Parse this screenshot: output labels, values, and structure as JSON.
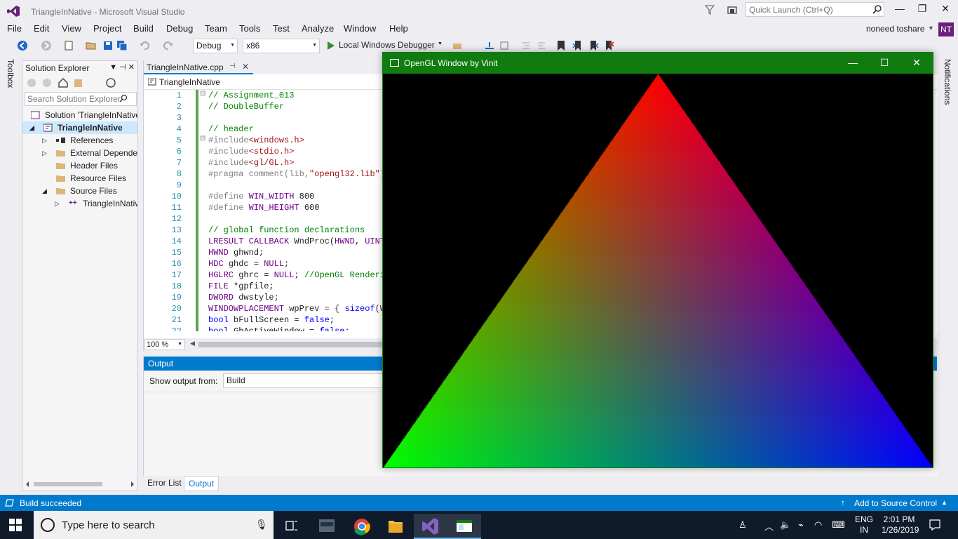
{
  "window": {
    "title": "TriangleInNative - Microsoft Visual Studio",
    "quick_launch_placeholder": "Quick Launch (Ctrl+Q)",
    "controls": {
      "minimize": "—",
      "restore": "❐",
      "close": "✕"
    }
  },
  "menu": {
    "items": [
      "File",
      "Edit",
      "View",
      "Project",
      "Build",
      "Debug",
      "Team",
      "Tools",
      "Test",
      "Analyze",
      "Window",
      "Help"
    ],
    "user": "noneed toshare",
    "avatar_initials": "NT"
  },
  "toolbar": {
    "configuration": "Debug",
    "platform": "x86",
    "debugger": "Local Windows Debugger"
  },
  "toolbox_label": "Toolbox",
  "notifications_label": "Notifications",
  "solution_explorer": {
    "title": "Solution Explorer",
    "search_placeholder": "Search Solution Explorer",
    "tree": [
      {
        "label": "Solution 'TriangleInNative'",
        "icon": "solution-icon"
      },
      {
        "label": "TriangleInNative",
        "icon": "project-icon",
        "selected": true
      },
      {
        "label": "References",
        "icon": "references-icon"
      },
      {
        "label": "External Dependencies",
        "icon": "folder-icon"
      },
      {
        "label": "Header Files",
        "icon": "folder-icon"
      },
      {
        "label": "Resource Files",
        "icon": "folder-icon"
      },
      {
        "label": "Source Files",
        "icon": "folder-icon"
      },
      {
        "label": "TriangleInNative.cpp",
        "icon": "cpp-file-icon"
      }
    ]
  },
  "editor": {
    "tab": "TriangleInNative.cpp",
    "nav_scope": "TriangleInNative",
    "zoom": "100 %",
    "lines": [
      {
        "n": "1",
        "parts": [
          {
            "c": "c-comment",
            "t": "// Assignment_013"
          }
        ]
      },
      {
        "n": "2",
        "parts": [
          {
            "c": "c-comment",
            "t": "// DoubleBuffer"
          }
        ]
      },
      {
        "n": "3",
        "parts": []
      },
      {
        "n": "4",
        "parts": [
          {
            "c": "c-comment",
            "t": "// header"
          }
        ]
      },
      {
        "n": "5",
        "parts": [
          {
            "c": "c-pre",
            "t": "#include"
          },
          {
            "c": "c-str",
            "t": "<windows.h>"
          }
        ]
      },
      {
        "n": "6",
        "parts": [
          {
            "c": "c-pre",
            "t": "#include"
          },
          {
            "c": "c-str",
            "t": "<stdio.h>"
          }
        ]
      },
      {
        "n": "7",
        "parts": [
          {
            "c": "c-pre",
            "t": "#include"
          },
          {
            "c": "c-str",
            "t": "<gl/GL.h>"
          }
        ]
      },
      {
        "n": "8",
        "parts": [
          {
            "c": "c-pre",
            "t": "#pragma comment(lib,"
          },
          {
            "c": "c-str",
            "t": "\"opengl32.lib\""
          },
          {
            "c": "c-pre",
            "t": ")"
          }
        ]
      },
      {
        "n": "9",
        "parts": []
      },
      {
        "n": "10",
        "parts": [
          {
            "c": "c-pre",
            "t": "#define "
          },
          {
            "c": "c-macro",
            "t": "WIN_WIDTH"
          },
          {
            "c": "",
            "t": " 800"
          }
        ]
      },
      {
        "n": "11",
        "parts": [
          {
            "c": "c-pre",
            "t": "#define "
          },
          {
            "c": "c-macro",
            "t": "WIN_HEIGHT"
          },
          {
            "c": "",
            "t": " 600"
          }
        ]
      },
      {
        "n": "12",
        "parts": []
      },
      {
        "n": "13",
        "parts": [
          {
            "c": "c-comment",
            "t": "// global function declarations"
          }
        ]
      },
      {
        "n": "14",
        "parts": [
          {
            "c": "c-macro",
            "t": "LRESULT"
          },
          {
            "c": "",
            "t": " "
          },
          {
            "c": "c-macro",
            "t": "CALLBACK"
          },
          {
            "c": "",
            "t": " WndProc("
          },
          {
            "c": "c-macro",
            "t": "HWND"
          },
          {
            "c": "",
            "t": ", "
          },
          {
            "c": "c-macro",
            "t": "UINT"
          },
          {
            "c": "",
            "t": ","
          }
        ]
      },
      {
        "n": "15",
        "parts": [
          {
            "c": "c-macro",
            "t": "HWND"
          },
          {
            "c": "",
            "t": " ghwnd;"
          }
        ]
      },
      {
        "n": "16",
        "parts": [
          {
            "c": "c-macro",
            "t": "HDC"
          },
          {
            "c": "",
            "t": " ghdc = "
          },
          {
            "c": "c-macro",
            "t": "NULL"
          },
          {
            "c": "",
            "t": ";"
          }
        ]
      },
      {
        "n": "17",
        "parts": [
          {
            "c": "c-macro",
            "t": "HGLRC"
          },
          {
            "c": "",
            "t": " ghrc = "
          },
          {
            "c": "c-macro",
            "t": "NULL"
          },
          {
            "c": "",
            "t": "; "
          },
          {
            "c": "c-comment",
            "t": "//OpenGL Renderin"
          }
        ]
      },
      {
        "n": "18",
        "parts": [
          {
            "c": "c-macro",
            "t": "FILE"
          },
          {
            "c": "",
            "t": " *gpfile;"
          }
        ]
      },
      {
        "n": "19",
        "parts": [
          {
            "c": "c-macro",
            "t": "DWORD"
          },
          {
            "c": "",
            "t": " dwstyle;"
          }
        ]
      },
      {
        "n": "20",
        "parts": [
          {
            "c": "c-macro",
            "t": "WINDOWPLACEMENT"
          },
          {
            "c": "",
            "t": " wpPrev = { "
          },
          {
            "c": "c-kw",
            "t": "sizeof"
          },
          {
            "c": "",
            "t": "("
          },
          {
            "c": "c-macro",
            "t": "WI"
          }
        ]
      },
      {
        "n": "21",
        "parts": [
          {
            "c": "c-kw",
            "t": "bool"
          },
          {
            "c": "",
            "t": " bFullScreen = "
          },
          {
            "c": "c-kw",
            "t": "false"
          },
          {
            "c": "",
            "t": ";"
          }
        ]
      },
      {
        "n": "22",
        "parts": [
          {
            "c": "c-kw",
            "t": "bool"
          },
          {
            "c": "",
            "t": " GbActiveWindow = "
          },
          {
            "c": "c-kw",
            "t": "false"
          },
          {
            "c": "",
            "t": ";"
          }
        ]
      }
    ]
  },
  "output": {
    "title": "Output",
    "show_from_label": "Show output from:",
    "source": "Build"
  },
  "bottom_tabs": [
    "Error List",
    "Output"
  ],
  "status": {
    "message": "Build succeeded",
    "source_control": "Add to Source Control"
  },
  "gl_window": {
    "title": "OpenGL Window by Vinit",
    "background": "#000000",
    "triangle_colors": {
      "top": "#ff0000",
      "left": "#00ff00",
      "right": "#0000ff"
    }
  },
  "taskbar": {
    "search_placeholder": "Type here to search",
    "apps": [
      "task-view-icon",
      "glview-icon",
      "chrome-icon",
      "file-explorer-icon",
      "visual-studio-icon",
      "opengl-app-icon"
    ],
    "lang_top": "ENG",
    "lang_bottom": "IN",
    "time": "2:01 PM",
    "date": "1/26/2019"
  },
  "colors": {
    "accent": "#007acc",
    "gl_title": "#107c10",
    "vs_purple": "#68217a",
    "taskbar": "#0f1b2b"
  }
}
